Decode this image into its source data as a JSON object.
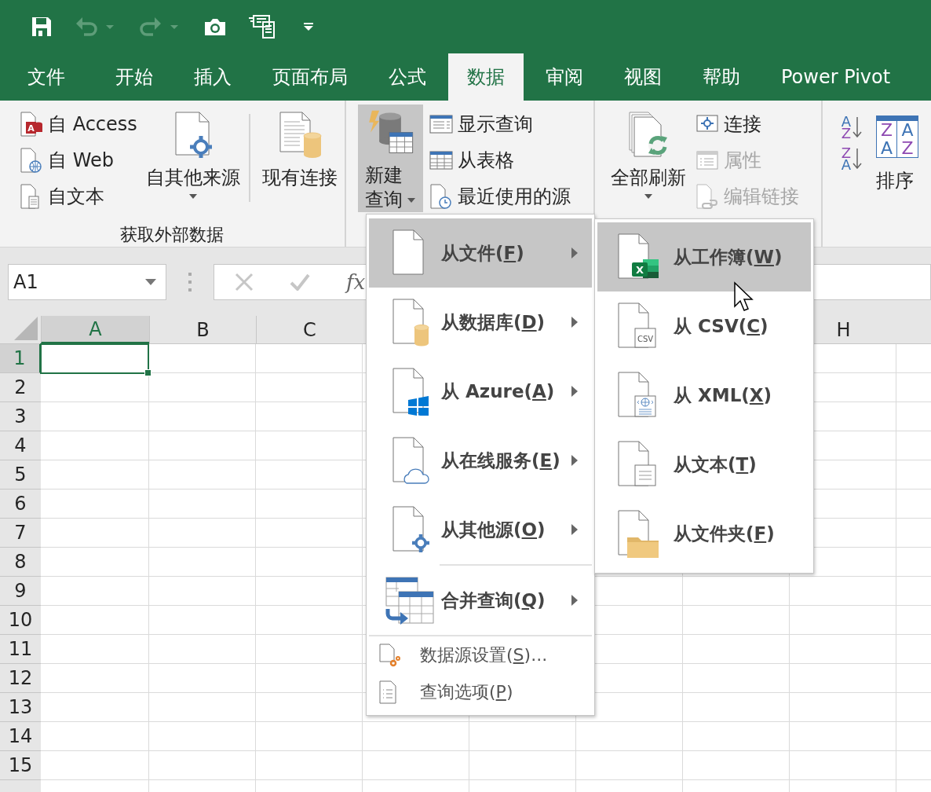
{
  "quick_access": [
    {
      "kind": "save",
      "disabled": false
    },
    {
      "kind": "undo",
      "disabled": true
    },
    {
      "kind": "redo",
      "disabled": true
    },
    {
      "kind": "camera",
      "disabled": false
    },
    {
      "kind": "form",
      "disabled": false
    },
    {
      "kind": "customize",
      "disabled": false
    }
  ],
  "tabs": [
    {
      "label": "文件",
      "selected": false
    },
    {
      "label": "开始",
      "selected": false
    },
    {
      "label": "插入",
      "selected": false
    },
    {
      "label": "页面布局",
      "selected": false
    },
    {
      "label": "公式",
      "selected": false
    },
    {
      "label": "数据",
      "selected": true
    },
    {
      "label": "审阅",
      "selected": false
    },
    {
      "label": "视图",
      "selected": false
    },
    {
      "label": "帮助",
      "selected": false
    },
    {
      "label": "Power Pivot",
      "selected": false
    }
  ],
  "ribbon": {
    "get_external_data": {
      "label": "获取外部数据",
      "small_buttons": [
        {
          "label": "自 Access",
          "icon_label": "A",
          "disabled": false
        },
        {
          "label": "自 Web",
          "disabled": false
        },
        {
          "label": "自文本",
          "disabled": false
        }
      ],
      "other_sources": {
        "label": "自其他来源"
      },
      "existing_connections": {
        "label": "现有连接"
      }
    },
    "get_and_transform": {
      "new_query": {
        "label": "新建查询",
        "pressed": true
      },
      "small_buttons": [
        {
          "label": "显示查询",
          "disabled": false
        },
        {
          "label": "从表格",
          "disabled": false
        },
        {
          "label": "最近使用的源",
          "disabled": false
        }
      ]
    },
    "connections": {
      "refresh_all": {
        "label": "全部刷新"
      },
      "small_buttons": [
        {
          "label": "连接",
          "disabled": false
        },
        {
          "label": "属性",
          "disabled": true
        },
        {
          "label": "编辑链接",
          "disabled": true
        }
      ]
    },
    "sort_filter": {
      "sort_buttons": [
        {
          "kind": "ascending",
          "letters": [
            "A",
            "Z"
          ]
        },
        {
          "kind": "descending",
          "letters": [
            "Z",
            "A"
          ]
        }
      ],
      "sort": {
        "label": "排序",
        "letters": [
          "Z",
          "A",
          "A",
          "Z"
        ]
      }
    }
  },
  "formula_bar": {
    "name_box": "A1",
    "function_label": "fx"
  },
  "sheet": {
    "columns": [
      {
        "label": "A",
        "selected": true
      },
      {
        "label": "B",
        "selected": false
      },
      {
        "label": "C",
        "selected": false
      },
      {
        "label": "H",
        "selected": false
      }
    ],
    "rows": [
      {
        "label": "1",
        "selected": true
      },
      {
        "label": "2",
        "selected": false
      },
      {
        "label": "3",
        "selected": false
      },
      {
        "label": "4",
        "selected": false
      },
      {
        "label": "5",
        "selected": false
      },
      {
        "label": "6",
        "selected": false
      },
      {
        "label": "7",
        "selected": false
      },
      {
        "label": "8",
        "selected": false
      },
      {
        "label": "9",
        "selected": false
      },
      {
        "label": "10",
        "selected": false
      },
      {
        "label": "11",
        "selected": false
      },
      {
        "label": "12",
        "selected": false
      },
      {
        "label": "13",
        "selected": false
      },
      {
        "label": "14",
        "selected": false
      },
      {
        "label": "15",
        "selected": false
      }
    ]
  },
  "query_menu": {
    "items": [
      {
        "kind": "large",
        "text": "从文件(",
        "access_key": "F",
        "suffix": ")",
        "submenu": true,
        "selected": true
      },
      {
        "kind": "large",
        "text": "从数据库(",
        "access_key": "D",
        "suffix": ")",
        "submenu": true,
        "selected": false
      },
      {
        "kind": "large",
        "text": "从 Azure(",
        "access_key": "A",
        "suffix": ")",
        "submenu": true,
        "selected": false
      },
      {
        "kind": "large",
        "text": "从在线服务(",
        "access_key": "E",
        "suffix": ")",
        "submenu": true,
        "selected": false
      },
      {
        "kind": "large",
        "text": "从其他源(",
        "access_key": "O",
        "suffix": ")",
        "submenu": true,
        "selected": false
      },
      {
        "kind": "separator"
      },
      {
        "kind": "large",
        "text": "合并查询(",
        "access_key": "Q",
        "suffix": ")",
        "submenu": true,
        "selected": false
      },
      {
        "kind": "separator"
      },
      {
        "kind": "small",
        "text": "数据源设置(",
        "access_key": "S",
        "suffix": ")...",
        "selected": false
      },
      {
        "kind": "small",
        "text": "查询选项(",
        "access_key": "P",
        "suffix": ")",
        "selected": false
      }
    ]
  },
  "file_submenu": {
    "items": [
      {
        "text": "从工作簿(",
        "access_key": "W",
        "suffix": ")",
        "icon_label": "X",
        "selected": true
      },
      {
        "text": "从 CSV(",
        "access_key": "C",
        "suffix": ")",
        "icon_label": "CSV",
        "selected": false
      },
      {
        "text": "从 XML(",
        "access_key": "X",
        "suffix": ")",
        "selected": false
      },
      {
        "text": "从文本(",
        "access_key": "T",
        "suffix": ")",
        "selected": false
      },
      {
        "text": "从文件夹(",
        "access_key": "F",
        "suffix": ")",
        "selected": false
      }
    ]
  }
}
